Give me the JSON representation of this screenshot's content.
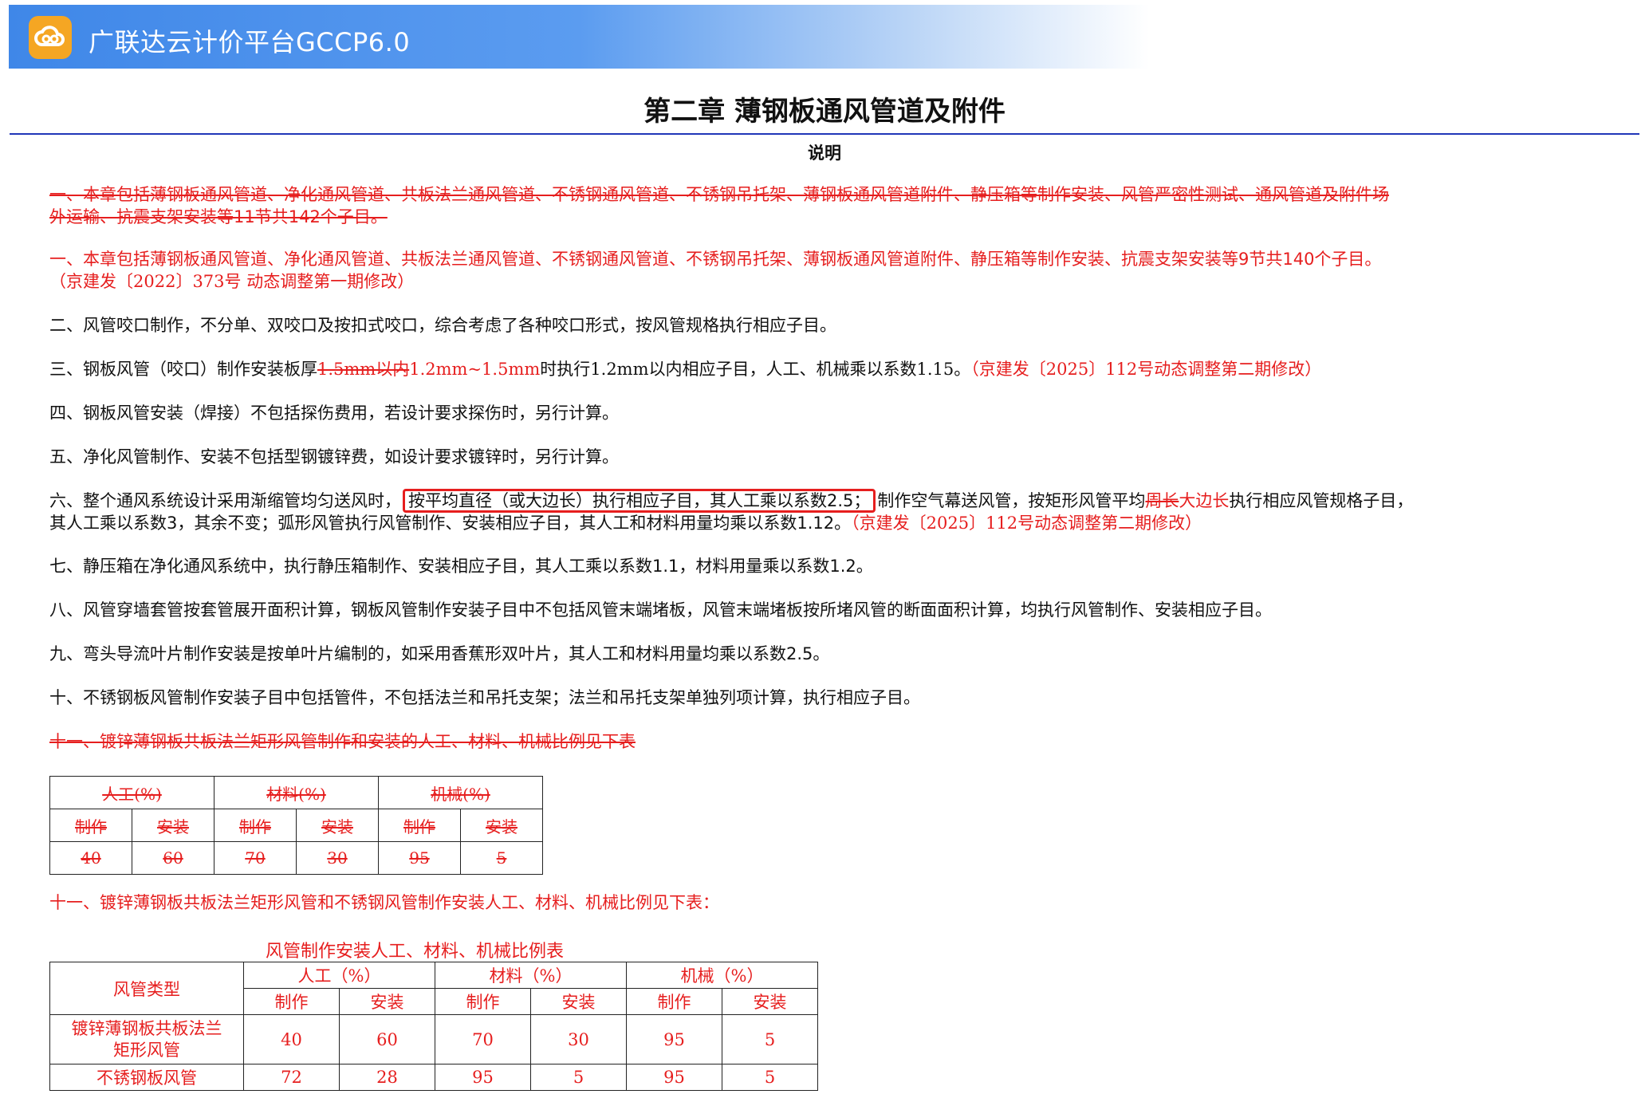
{
  "app": {
    "title": "广联达云计价平台GCCP6.0",
    "logo_icon": "cloud-logo-icon",
    "brand_color": "#f5a623"
  },
  "chapter": {
    "title": "第二章  薄钢板通风管道及附件",
    "subtitle": "说明"
  },
  "p1_old": "一、本章包括薄钢板通风管道、净化通风管道、共板法兰通风管道、不锈钢通风管道、不锈钢吊托架、薄钢板通风管道附件、静压箱等制作安装、风管严密性测试、通风管道及附件场",
  "p1_old2": "外运输、抗震支架安装等11节共142个子目。",
  "p1_new": "一、本章包括薄钢板通风管道、净化通风管道、共板法兰通风管道、不锈钢通风管道、不锈钢吊托架、薄钢板通风管道附件、静压箱等制作安装、抗震支架安装等9节共140个子目。",
  "p1_new2": "（京建发〔2022〕373号 动态调整第一期修改）",
  "p2": "二、风管咬口制作，不分单、双咬口及按扣式咬口，综合考虑了各种咬口形式，按风管规格执行相应子目。",
  "p3": {
    "a": "三、钢板风管（咬口）制作安装板厚",
    "old": "1.5mm以内",
    "new": "1.2mm~1.5mm",
    "b": "时执行1.2mm以内相应子目，人工、机械乘以系数1.15。",
    "note": "（京建发〔2025〕112号动态调整第二期修改）"
  },
  "p4": "四、钢板风管安装（焊接）不包括探伤费用，若设计要求探伤时，另行计算。",
  "p5": "五、净化风管制作、安装不包括型钢镀锌费，如设计要求镀锌时，另行计算。",
  "p6": {
    "a": "六、整个通风系统设计采用渐缩管均匀送风时，",
    "highlight": "按平均直径（或大边长）执行相应子目，其人工乘以系数2.5；",
    "b": "制作空气幕送风管，按矩形风管平均",
    "old": "周长",
    "new": "大边长",
    "c": "执行相应风管规格子目，",
    "line2": "其人工乘以系数3，其余不变；弧形风管执行风管制作、安装相应子目，其人工和材料用量均乘以系数1.12。",
    "note": "（京建发〔2025〕112号动态调整第二期修改）"
  },
  "p7": "七、静压箱在净化通风系统中，执行静压箱制作、安装相应子目，其人工乘以系数1.1，材料用量乘以系数1.2。",
  "p8": "八、风管穿墙套管按套管展开面积计算，钢板风管制作安装子目中不包括风管末端堵板，风管末端堵板按所堵风管的断面面积计算，均执行风管制作、安装相应子目。",
  "p9": "九、弯头导流叶片制作安装是按单叶片编制的，如采用香蕉形双叶片，其人工和材料用量均乘以系数2.5。",
  "p10": "十、不锈钢板风管制作安装子目中包括管件，不包括法兰和吊托支架；法兰和吊托支架单独列项计算，执行相应子目。",
  "p11_old": "十一、镀锌薄钢板共板法兰矩形风管制作和安装的人工、材料、机械比例见下表",
  "table_old": {
    "groups": [
      "人工(%)",
      "材料(%)",
      "机械(%)"
    ],
    "sub": [
      "制作",
      "安装",
      "制作",
      "安装",
      "制作",
      "安装"
    ],
    "values": [
      "40",
      "60",
      "70",
      "30",
      "95",
      "5"
    ]
  },
  "p11_new": "十一、镀锌薄钢板共板法兰矩形风管和不锈钢风管制作安装人工、材料、机械比例见下表：",
  "table_new": {
    "caption": "风管制作安装人工、材料、机械比例表",
    "type_header": "风管类型",
    "groups": [
      "人工（%）",
      "材料（%）",
      "机械（%）"
    ],
    "sub": [
      "制作",
      "安装",
      "制作",
      "安装",
      "制作",
      "安装"
    ],
    "rows": [
      {
        "type": "镀锌薄钢板共板法兰矩形风管",
        "type_l1": "镀锌薄钢板共板法兰",
        "type_l2": "矩形风管",
        "values": [
          "40",
          "60",
          "70",
          "30",
          "95",
          "5"
        ]
      },
      {
        "type": "不锈钢板风管",
        "values": [
          "72",
          "28",
          "95",
          "5",
          "95",
          "5"
        ]
      }
    ]
  }
}
